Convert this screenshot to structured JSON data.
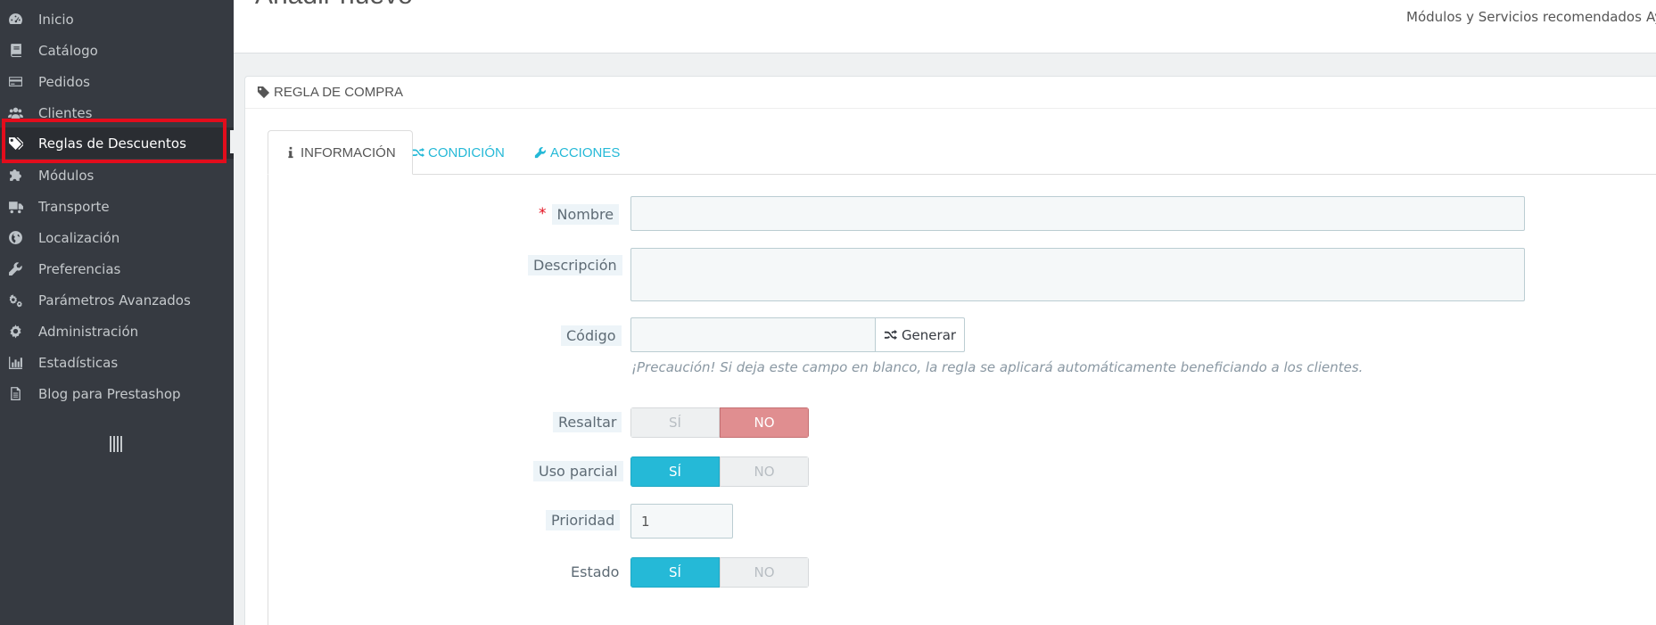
{
  "sidebar": {
    "items": [
      {
        "label": "Inicio",
        "icon": "dashboard-icon"
      },
      {
        "label": "Catálogo",
        "icon": "book-icon"
      },
      {
        "label": "Pedidos",
        "icon": "credit-card-icon"
      },
      {
        "label": "Clientes",
        "icon": "users-icon"
      },
      {
        "label": "Reglas de Descuentos",
        "icon": "tags-icon",
        "active": true
      },
      {
        "label": "Módulos",
        "icon": "puzzle-icon"
      },
      {
        "label": "Transporte",
        "icon": "truck-icon"
      },
      {
        "label": "Localización",
        "icon": "globe-icon"
      },
      {
        "label": "Preferencias",
        "icon": "wrench-icon"
      },
      {
        "label": "Parámetros Avanzados",
        "icon": "cogs-icon"
      },
      {
        "label": "Administración",
        "icon": "cog-icon"
      },
      {
        "label": "Estadísticas",
        "icon": "bar-chart-icon"
      },
      {
        "label": "Blog para Prestashop",
        "icon": "document-icon"
      }
    ],
    "highlight_color": "#e30d1c"
  },
  "header": {
    "title": "Añadir nuevo",
    "link": "Módulos y Servicios recomendados",
    "link2": "Ay"
  },
  "panel": {
    "heading": "REGLA DE COMPRA",
    "tabs": [
      {
        "label": "INFORMACIÓN",
        "icon": "info-icon",
        "active": true
      },
      {
        "label": "CONDICIÓN",
        "icon": "random-icon"
      },
      {
        "label": "ACCIONES",
        "icon": "wrench-icon"
      }
    ]
  },
  "form": {
    "name": {
      "label": "Nombre",
      "required_mark": "*",
      "value": ""
    },
    "description": {
      "label": "Descripción",
      "value": ""
    },
    "code": {
      "label": "Código",
      "value": "",
      "button": "Generar",
      "help": "¡Precaución! Si deja este campo en blanco, la regla se aplicará automáticamente beneficiando a los clientes."
    },
    "highlight": {
      "label": "Resaltar",
      "yes": "SÍ",
      "no": "NO",
      "value": "NO"
    },
    "partial_use": {
      "label": "Uso parcial",
      "yes": "SÍ",
      "no": "NO",
      "value": "SÍ"
    },
    "priority": {
      "label": "Prioridad",
      "value": "1"
    },
    "status": {
      "label": "Estado",
      "yes": "SÍ",
      "no": "NO",
      "value": "SÍ"
    }
  },
  "colors": {
    "accent": "#25b9d7",
    "danger_switch": "#e08e90",
    "sidebar_bg": "#363a41"
  }
}
